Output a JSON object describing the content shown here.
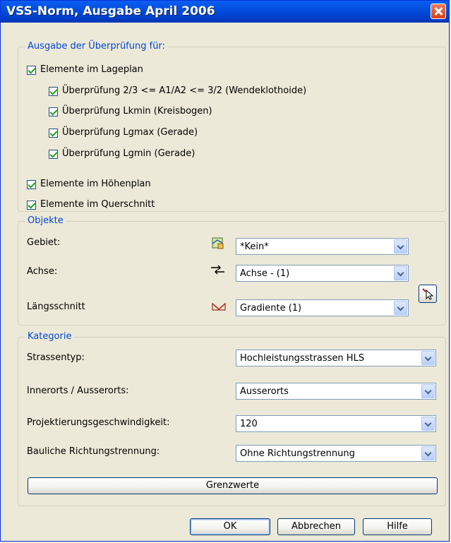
{
  "window": {
    "title": "VSS-Norm, Ausgabe April 2006"
  },
  "ausgabe": {
    "legend": "Ausgabe der Überprüfung für:",
    "lageplan": "Elemente im Lageplan",
    "sub": [
      "Überprüfung 2/3 <= A1/A2 <= 3/2 (Wendeklothoide)",
      "Überprüfung Lkmin (Kreisbogen)",
      "Überprüfung Lgmax (Gerade)",
      "Überprüfung Lgmin (Gerade)"
    ],
    "hoehenplan": "Elemente im Höhenplan",
    "querschnitt": "Elemente im Querschnitt"
  },
  "objekte": {
    "legend": "Objekte",
    "gebiet_label": "Gebiet:",
    "gebiet_value": "*Kein*",
    "achse_label": "Achse:",
    "achse_value": "Achse - (1)",
    "laengsschnitt_label": "Längsschnitt",
    "laengsschnitt_value": "Gradiente (1)"
  },
  "kategorie": {
    "legend": "Kategorie",
    "strassentyp_label": "Strassentyp:",
    "strassentyp_value": "Hochleistungsstrassen HLS",
    "innerorts_label": "Innerorts / Ausserorts:",
    "innerorts_value": "Ausserorts",
    "projektierung_label": "Projektierungsgeschwindigkeit:",
    "projektierung_value": "120",
    "richtung_label": "Bauliche Richtungstrennung:",
    "richtung_value": "Ohne Richtungstrennung",
    "grenzwerte_label": "Grenzwerte"
  },
  "buttons": {
    "ok": "OK",
    "abbrechen": "Abbrechen",
    "hilfe": "Hilfe"
  },
  "colors": {
    "titlebar": "#0046d5",
    "accent": "#0046d5",
    "close": "#d8401a",
    "check": "#21a121"
  },
  "icons": {
    "gebiet": "area-map-icon",
    "achse": "axis-arrow-icon",
    "laengsschnitt": "profile-icon",
    "pick": "pick-cursor-icon",
    "close": "close-icon"
  }
}
